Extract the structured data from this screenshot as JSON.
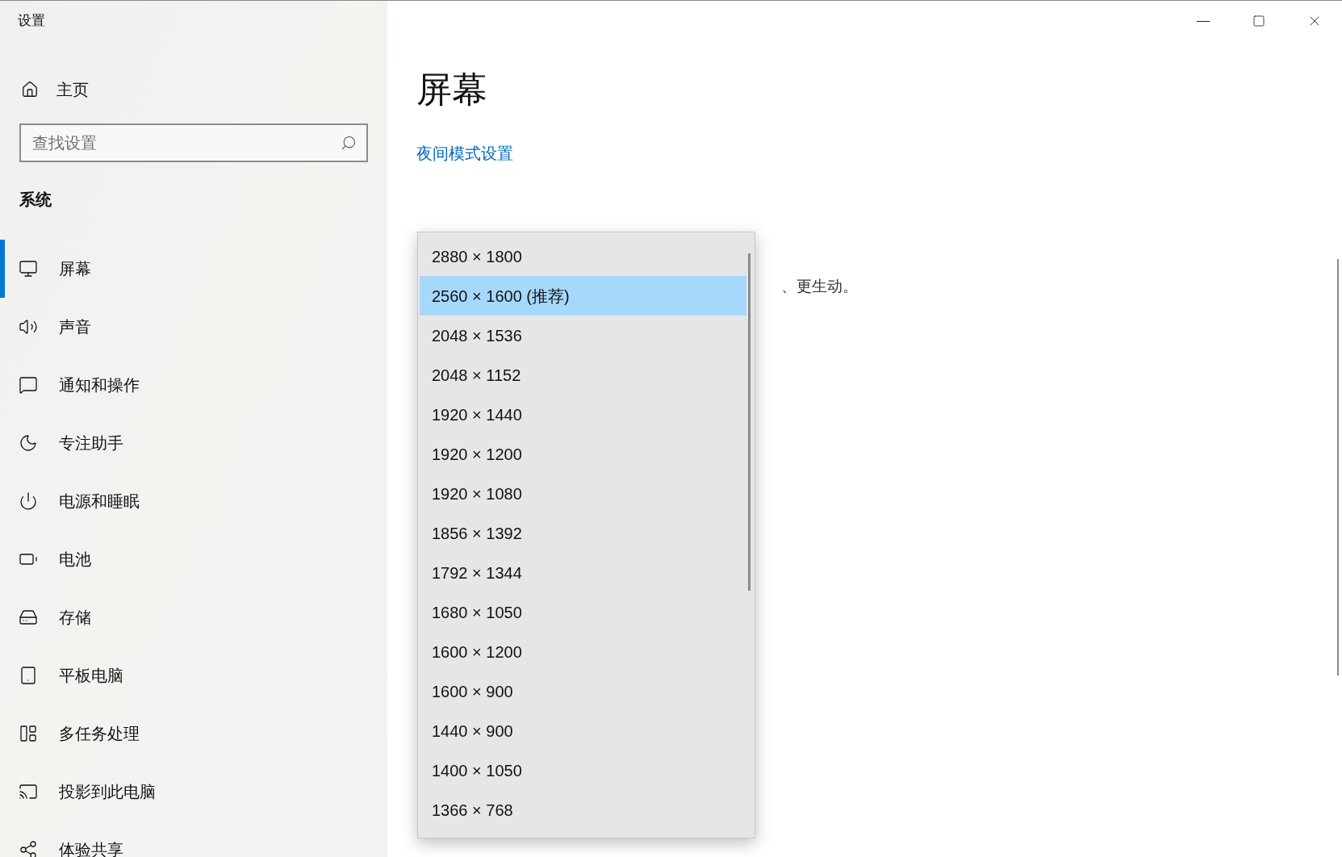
{
  "window": {
    "title": "设置"
  },
  "sidebar": {
    "home": "主页",
    "search": {
      "placeholder": "查找设置"
    },
    "section": "系统",
    "items": [
      {
        "label": "屏幕",
        "selected": true
      },
      {
        "label": "声音",
        "selected": false
      },
      {
        "label": "通知和操作",
        "selected": false
      },
      {
        "label": "专注助手",
        "selected": false
      },
      {
        "label": "电源和睡眠",
        "selected": false
      },
      {
        "label": "电池",
        "selected": false
      },
      {
        "label": "存储",
        "selected": false
      },
      {
        "label": "平板电脑",
        "selected": false
      },
      {
        "label": "多任务处理",
        "selected": false
      },
      {
        "label": "投影到此电脑",
        "selected": false
      },
      {
        "label": "体验共享",
        "selected": false
      }
    ]
  },
  "main": {
    "heading": "屏幕",
    "night_link": "夜间模式设置",
    "hd_color_text": "、更生动。"
  },
  "resolution_dropdown": {
    "options": [
      {
        "label": "2880 × 1800",
        "selected": false
      },
      {
        "label": "2560 × 1600 (推荐)",
        "selected": true
      },
      {
        "label": "2048 × 1536",
        "selected": false
      },
      {
        "label": "2048 × 1152",
        "selected": false
      },
      {
        "label": "1920 × 1440",
        "selected": false
      },
      {
        "label": "1920 × 1200",
        "selected": false
      },
      {
        "label": "1920 × 1080",
        "selected": false
      },
      {
        "label": "1856 × 1392",
        "selected": false
      },
      {
        "label": "1792 × 1344",
        "selected": false
      },
      {
        "label": "1680 × 1050",
        "selected": false
      },
      {
        "label": "1600 × 1200",
        "selected": false
      },
      {
        "label": "1600 × 900",
        "selected": false
      },
      {
        "label": "1440 × 900",
        "selected": false
      },
      {
        "label": "1400 × 1050",
        "selected": false
      },
      {
        "label": "1366 × 768",
        "selected": false
      }
    ]
  }
}
